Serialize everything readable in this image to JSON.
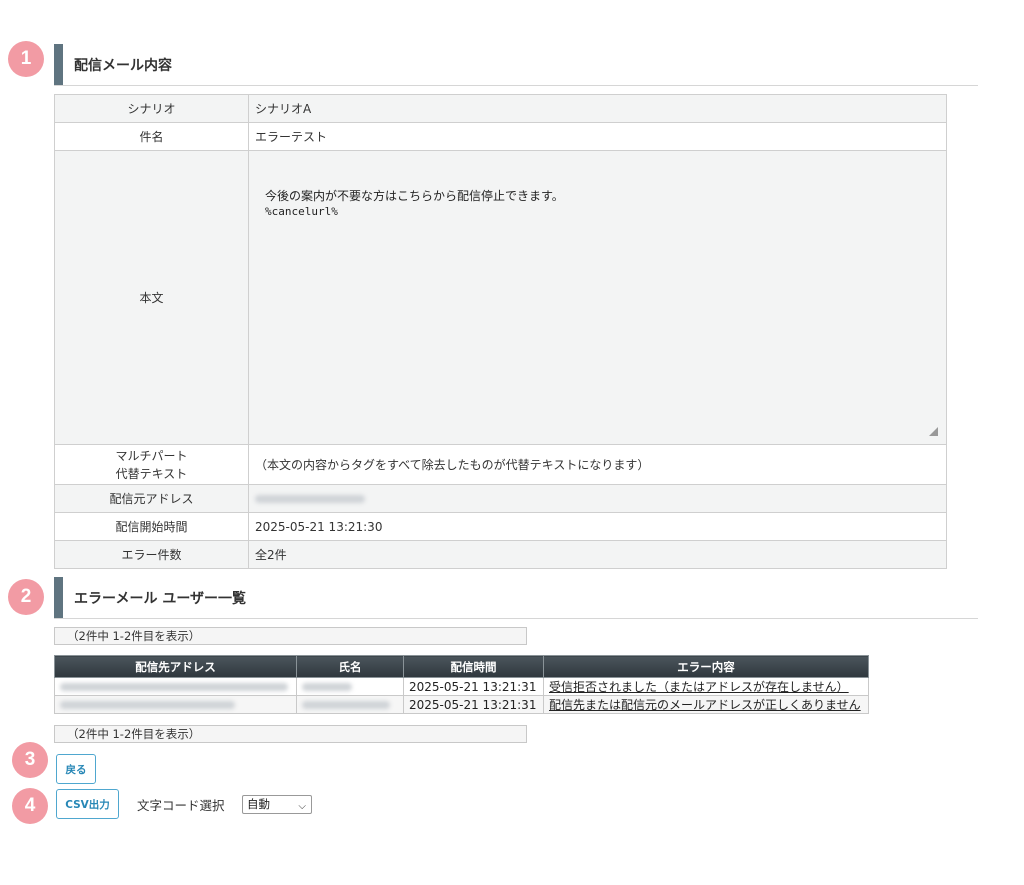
{
  "steps": [
    "1",
    "2",
    "3",
    "4"
  ],
  "section1": {
    "title": "配信メール内容",
    "rows": {
      "scenario": {
        "label": "シナリオ",
        "value": "シナリオA"
      },
      "subject": {
        "label": "件名",
        "value": "エラーテスト"
      },
      "body": {
        "label": "本文",
        "line1": "今後の案内が不要な方はこちらから配信停止できます。",
        "line2": "%cancelurl%"
      },
      "multipart": {
        "label_line1": "マルチパート",
        "label_line2": "代替テキスト",
        "value": "（本文の内容からタグをすべて除去したものが代替テキストになります）"
      },
      "from": {
        "label": "配信元アドレス"
      },
      "start": {
        "label": "配信開始時間",
        "value": "2025-05-21 13:21:30"
      },
      "errors": {
        "label": "エラー件数",
        "value": "全2件"
      }
    }
  },
  "section2": {
    "title": "エラーメール ユーザー一覧",
    "pager_text": "（2件中 1-2件目を表示）",
    "columns": [
      "配信先アドレス",
      "氏名",
      "配信時間",
      "エラー内容"
    ],
    "rows": [
      {
        "time": "2025-05-21 13:21:31",
        "error": "受信拒否されました（またはアドレスが存在しません）"
      },
      {
        "time": "2025-05-21 13:21:31",
        "error": "配信先または配信元のメールアドレスが正しくありません"
      }
    ]
  },
  "actions": {
    "back_label": "戻る",
    "csv_label": "CSV出力",
    "encoding_label": "文字コード選択",
    "encoding_value": "自動"
  },
  "colors": {
    "badge": "#f29ba4",
    "section_bar": "#5f7480",
    "button_accent": "#2787b6"
  }
}
